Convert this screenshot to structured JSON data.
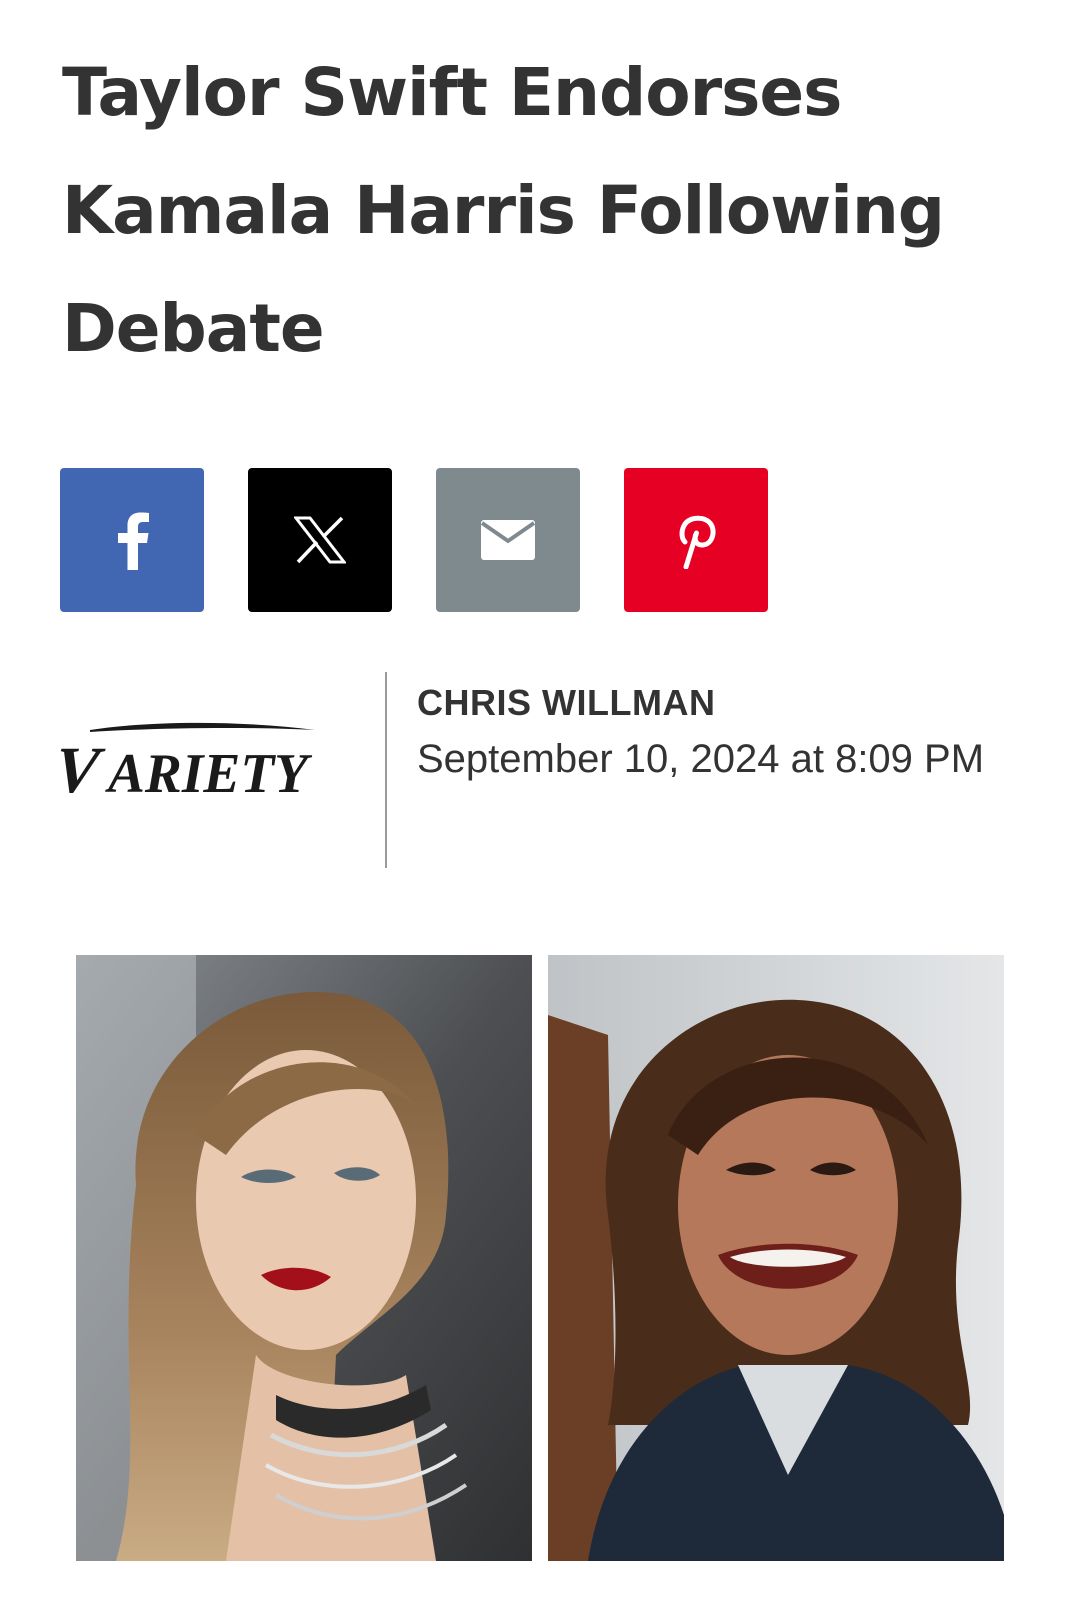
{
  "article": {
    "title": "Taylor Swift Endorses Kamala Harris Following Debate"
  },
  "share": {
    "buttons": [
      {
        "icon": "facebook-icon",
        "color": "#4267B2"
      },
      {
        "icon": "x-icon",
        "color": "#000000"
      },
      {
        "icon": "email-icon",
        "color": "#7E8A8E"
      },
      {
        "icon": "pinterest-icon",
        "color": "#E60023"
      }
    ]
  },
  "byline": {
    "brand": "VARIETY",
    "author": "CHRIS WILLMAN",
    "date": "September 10, 2024 at 8:09 PM"
  },
  "images": [
    {
      "subject": "taylor-swift-photo"
    },
    {
      "subject": "kamala-harris-photo"
    }
  ]
}
